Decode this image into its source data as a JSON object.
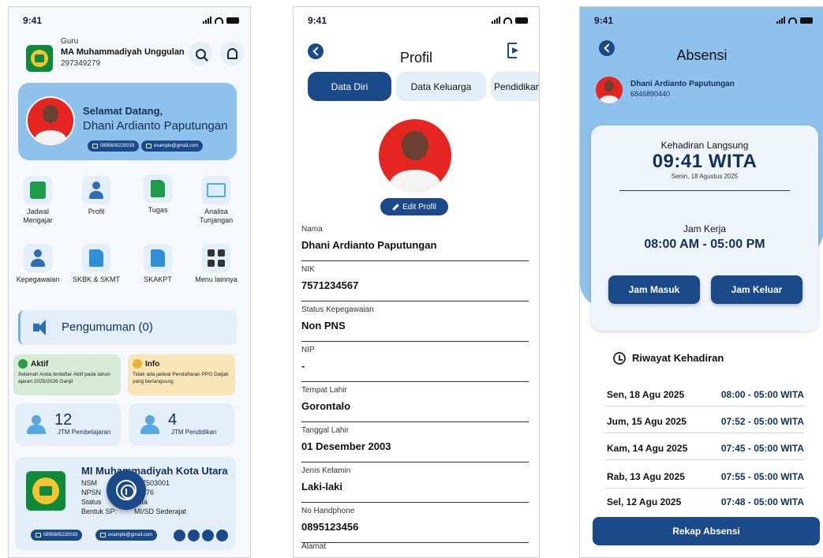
{
  "status_time": "9:41",
  "home": {
    "role": "Guru",
    "school": "MA Muhammadiyah Unggulan",
    "code": "297349279",
    "greeting": "Selamat Datang,",
    "name": "Dhani Ardianto Paputungan",
    "phone": "0895605220033",
    "email": "example@gmail.com",
    "menu": [
      {
        "label": "Jadwal Mengajar",
        "icon": "schedule-icon"
      },
      {
        "label": "Profil",
        "icon": "person-icon"
      },
      {
        "label": "Tugas",
        "icon": "task-icon"
      },
      {
        "label": "Analisa Tunjangan",
        "icon": "chart-icon"
      },
      {
        "label": "Kepegawaian",
        "icon": "staff-icon"
      },
      {
        "label": "SKBK & SKMT",
        "icon": "document-icon"
      },
      {
        "label": "SKAKPT",
        "icon": "file-icon"
      },
      {
        "label": "Menu lainnya",
        "icon": "grid-icon"
      }
    ],
    "announcement": "Pengumuman (0)",
    "aktif_title": "Aktif",
    "aktif_desc": "Selamat! Anda terdaftar Aktif pada tahun ajaran 2025/2026 Ganjil",
    "info_title": "Info",
    "info_desc": "Tidak ada jadwal Pendaftaran PPG Daljab yang berlangsung",
    "stat1_value": "12",
    "stat1_label": "JTM Pembelajaran",
    "stat2_value": "4",
    "stat2_label": "JTM Pendidikan",
    "school_card": {
      "name": "MI Muhammadiyah Kota Utara",
      "nsm_label": "NSM",
      "nsm_value": "27503001",
      "npsn_label": "NPSN",
      "npsn_value": "1876",
      "status_label": "Status",
      "status_value": "sta",
      "bentuk_label": "Bentuk SP:",
      "bentuk_value": "MI/SD Sederajat",
      "phone": "0895605220033",
      "email": "example@gmail.com"
    }
  },
  "profile": {
    "title": "Profil",
    "tabs": [
      "Data Diri",
      "Data Keluarga",
      "Pendidikan"
    ],
    "edit_label": "Edit Profil",
    "fields": [
      {
        "label": "Nama",
        "value": "Dhani Ardianto Paputungan"
      },
      {
        "label": "NIK",
        "value": "7571234567"
      },
      {
        "label": "Status Kepegawaian",
        "value": "Non PNS"
      },
      {
        "label": "NIP",
        "value": "-"
      },
      {
        "label": "Tempat Lahir",
        "value": "Gorontalo"
      },
      {
        "label": "Tanggal Lahir",
        "value": "01 Desember 2003"
      },
      {
        "label": "Jenis Kelamin",
        "value": "Laki-laki"
      },
      {
        "label": "No Handphone",
        "value": "0895123456"
      },
      {
        "label": "Alamat",
        "value": ""
      }
    ]
  },
  "attendance": {
    "title": "Absensi",
    "name": "Dhani Ardianto Paputungan",
    "id": "6846890440",
    "live_label": "Kehadiran Langsung",
    "clock": "09:41 WITA",
    "date": "Senin, 18 Agustus 2025",
    "work_label": "Jam Kerja",
    "work_hours": "08:00 AM - 05:00 PM",
    "in_label": "Jam Masuk",
    "out_label": "Jam Keluar",
    "history_title": "Riwayat Kehadiran",
    "history": [
      {
        "date": "Sen, 18 Agu 2025",
        "time": "08:00 - 05:00 WITA"
      },
      {
        "date": "Jum, 15 Agu 2025",
        "time": "07:52 - 05:00 WITA"
      },
      {
        "date": "Kam, 14 Agu 2025",
        "time": "07:45 - 05:00 WITA"
      },
      {
        "date": "Rab, 13 Agu 2025",
        "time": "07:55 - 05:00 WITA"
      },
      {
        "date": "Sel, 12 Agu 2025",
        "time": "07:48 - 05:00 WITA"
      }
    ],
    "rekap_label": "Rekap Absensi"
  }
}
